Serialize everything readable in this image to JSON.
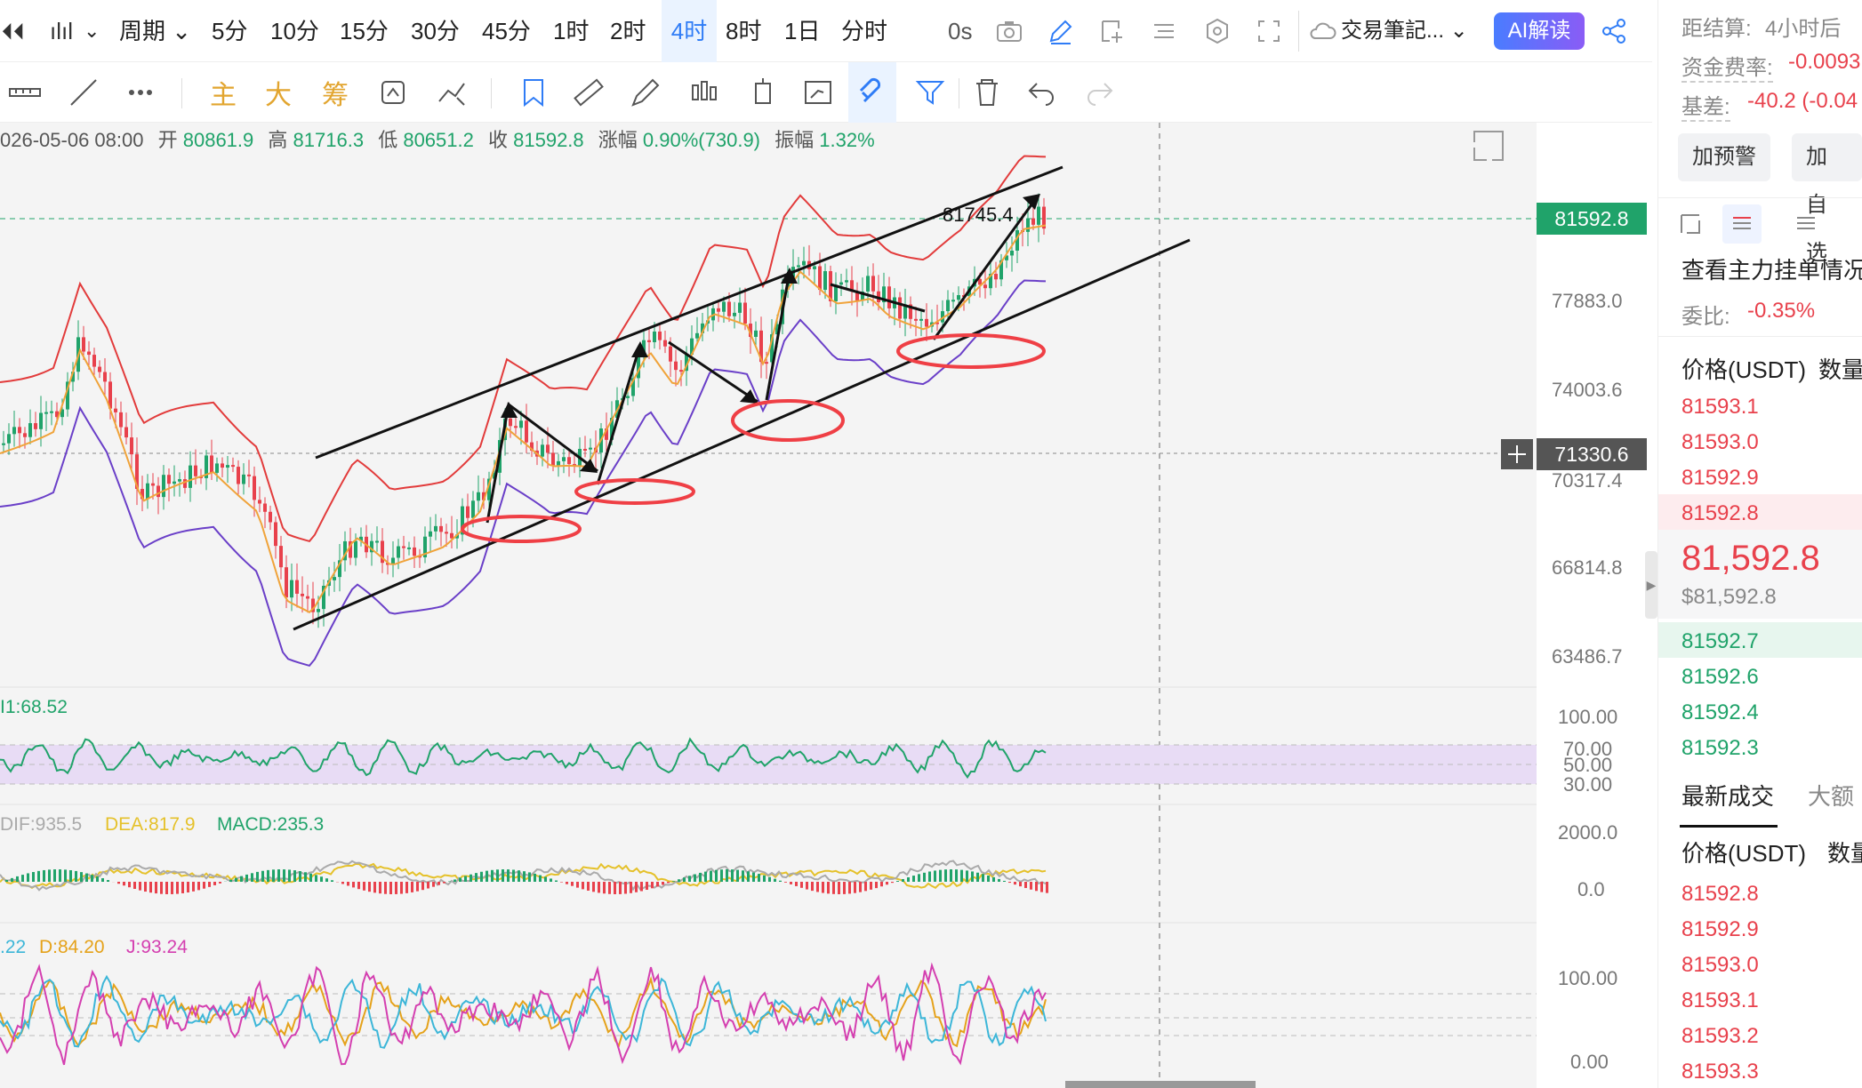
{
  "toolbar": {
    "back_icon": "⏴⏴",
    "chart_type": "ılıl",
    "period_label": "周期",
    "intervals": [
      "5分",
      "10分",
      "15分",
      "30分",
      "45分",
      "1时",
      "2时",
      "4时",
      "8时",
      "1日",
      "分时"
    ],
    "active_interval": "4时",
    "countdown": "0s",
    "trade_journal": "交易筆記...",
    "ai_button": "AI解读",
    "accent": "#2f7cf6"
  },
  "drawbar": {
    "indicator_main": "主",
    "indicator_big": "大",
    "indicator_chip": "筹",
    "highlight": "#e2a52f"
  },
  "ohlc": {
    "date": "026-05-06 08:00",
    "open_label": "开",
    "open": "80861.9",
    "high_label": "高",
    "high": "81716.3",
    "low_label": "低",
    "low": "80651.2",
    "close_label": "收",
    "close": "81592.8",
    "change_label": "涨幅",
    "change": "0.90%(730.9)",
    "amp_label": "振幅",
    "amp": "1.32%"
  },
  "price_axis": {
    "ticks": [
      "77883.0",
      "74003.6",
      "70317.4",
      "66814.8",
      "63486.7"
    ],
    "last_price": "81592.8",
    "crosshair_price": "71330.6",
    "peak_label": "81745.4"
  },
  "rsi": {
    "label": "I1:68.52",
    "ticks": [
      "100.00",
      "70.00",
      "50.00",
      "30.00"
    ]
  },
  "macd": {
    "dif": "DIF:935.5",
    "dea": "DEA:817.9",
    "macd": "MACD:235.3",
    "ticks": [
      "2000.0",
      "0.0"
    ]
  },
  "kdj": {
    "k": ".22",
    "d": "D:84.20",
    "j": "J:93.24",
    "ticks": [
      "100.00",
      "0.00"
    ]
  },
  "panel": {
    "settle_label": "距结算:",
    "settle_value": "4小时后",
    "funding_label": "资金费率:",
    "funding_value": "-0.0093",
    "basis_label": "基差:",
    "basis_value": "-40.2 (-0.04",
    "alert_button": "加预警",
    "watch_button": "加自选",
    "depth_title": "查看主力挂单情况",
    "ratio_label": "委比:",
    "ratio_value": "-0.35%",
    "col_price": "价格(USDT)",
    "col_qty": "数量",
    "asks": [
      "81593.1",
      "81593.0",
      "81592.9",
      "81592.8"
    ],
    "mid_price": "81,592.8",
    "mid_usd": "$81,592.8",
    "bids": [
      "81592.7",
      "81592.6",
      "81592.4",
      "81592.3"
    ],
    "trades_tab": "最新成交",
    "large_tab": "大额",
    "trade_col_price": "价格(USDT)",
    "trade_col_qty": "数量",
    "trades": [
      "81592.8",
      "81592.9",
      "81593.0",
      "81593.1",
      "81593.2",
      "81593.3"
    ]
  }
}
